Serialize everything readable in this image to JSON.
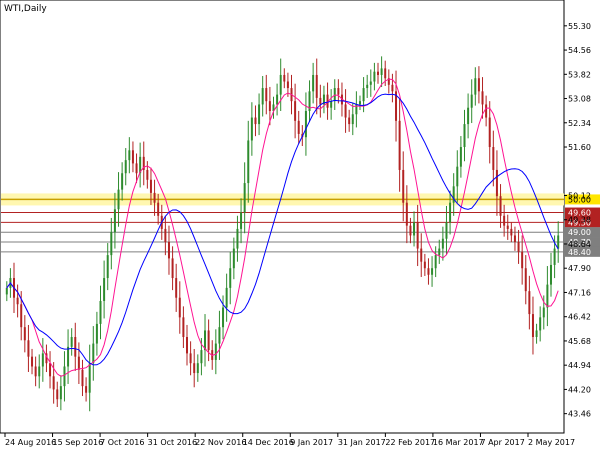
{
  "chart_data": {
    "type": "candlestick",
    "title": "WTI,Daily",
    "xlabel": "",
    "ylabel": "",
    "ylim": [
      42.9,
      55.6
    ],
    "grid": false,
    "y_ticks": [
      "55.30",
      "54.56",
      "53.82",
      "53.08",
      "52.34",
      "51.60",
      "50.12",
      "49.38",
      "48.64",
      "47.90",
      "47.16",
      "46.42",
      "45.68",
      "44.94",
      "44.20",
      "43.46"
    ],
    "x_ticks": [
      "24 Aug 2016",
      "15 Sep 2016",
      "7 Oct 2016",
      "31 Oct 2016",
      "22 Nov 2016",
      "14 Dec 2016",
      "9 Jan 2017",
      "31 Jan 2017",
      "22 Feb 2017",
      "16 Mar 2017",
      "7 Apr 2017",
      "2 May 2017"
    ],
    "horizontal_levels": [
      {
        "value": 50.0,
        "label": "50.00",
        "color": "#ffe600",
        "style": "band"
      },
      {
        "value": 49.6,
        "label": "49.60",
        "color": "#b22222"
      },
      {
        "value": 49.3,
        "label": "49.30",
        "color": "#b22222"
      },
      {
        "value": 49.0,
        "label": "49.00",
        "color": "#7f7f7f"
      },
      {
        "value": 48.7,
        "label": "48.70",
        "color": "#7f7f7f"
      },
      {
        "value": 48.4,
        "label": "48.40",
        "color": "#7f7f7f"
      }
    ],
    "candle_colors": {
      "up": "#2e8b2e",
      "down": "#b22222"
    },
    "close": [
      47.3,
      47.6,
      47.0,
      46.8,
      46.1,
      45.7,
      45.2,
      44.9,
      44.6,
      44.9,
      45.3,
      45.0,
      44.6,
      44.2,
      43.9,
      44.3,
      44.9,
      45.5,
      45.8,
      45.2,
      44.8,
      44.3,
      44.1,
      45.0,
      45.6,
      46.2,
      46.9,
      47.6,
      48.3,
      49.0,
      49.7,
      50.3,
      50.8,
      51.2,
      51.5,
      51.1,
      50.8,
      51.3,
      50.9,
      50.6,
      50.2,
      49.9,
      49.5,
      49.1,
      48.7,
      48.2,
      47.6,
      47.0,
      46.4,
      45.8,
      45.3,
      45.0,
      44.7,
      45.0,
      45.4,
      46.0,
      45.4,
      45.1,
      45.6,
      46.1,
      46.7,
      47.3,
      47.9,
      48.5,
      49.1,
      49.6,
      50.5,
      51.8,
      52.5,
      52.3,
      52.9,
      53.4,
      53.0,
      52.7,
      52.9,
      53.2,
      53.8,
      53.6,
      53.4,
      53.0,
      52.4,
      52.0,
      51.9,
      52.7,
      53.3,
      53.8,
      53.1,
      52.9,
      53.2,
      52.8,
      53.0,
      53.4,
      53.2,
      52.9,
      52.5,
      52.3,
      52.6,
      52.9,
      53.0,
      53.4,
      53.5,
      53.6,
      53.9,
      53.8,
      54.0,
      53.7,
      53.5,
      53.3,
      52.4,
      50.9,
      49.9,
      49.2,
      48.9,
      49.3,
      48.5,
      48.1,
      47.9,
      47.7,
      47.9,
      48.3,
      48.5,
      48.8,
      49.3,
      49.9,
      50.4,
      51.0,
      51.6,
      52.3,
      52.8,
      53.2,
      53.7,
      53.3,
      52.9,
      52.5,
      51.6,
      50.9,
      50.1,
      49.5,
      49.2,
      49.1,
      48.9,
      48.7,
      48.4,
      47.9,
      47.2,
      46.5,
      45.8,
      46.0,
      46.4,
      46.7,
      47.4,
      48.0,
      48.5,
      48.9
    ],
    "ma_fast": {
      "color": "#ff1493"
    },
    "ma_slow": {
      "color": "#0000ff"
    }
  }
}
